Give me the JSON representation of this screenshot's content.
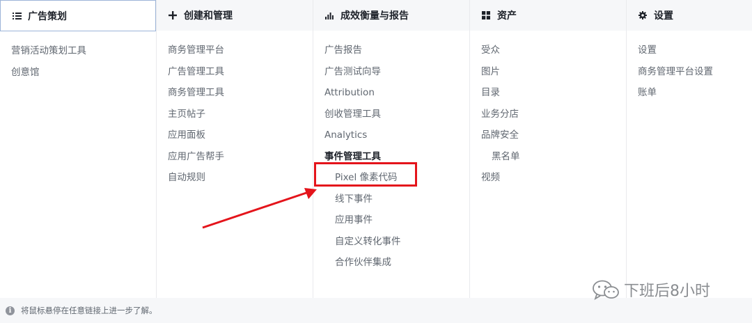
{
  "columns": [
    {
      "title": "广告策划",
      "icon": "list-icon",
      "items": [
        "营销活动策划工具",
        "创意馆"
      ]
    },
    {
      "title": "创建和管理",
      "icon": "plus-icon",
      "items": [
        "商务管理平台",
        "广告管理工具",
        "商务管理工具",
        "主页帖子",
        "应用面板",
        "应用广告帮手",
        "自动规则"
      ]
    },
    {
      "title": "成效衡量与报告",
      "icon": "bar-chart-icon",
      "items": [
        "广告报告",
        "广告测试向导",
        "Attribution",
        "创收管理工具",
        "Analytics",
        "事件管理工具",
        "Pixel 像素代码",
        "线下事件",
        "应用事件",
        "自定义转化事件",
        "合作伙伴集成"
      ]
    },
    {
      "title": "资产",
      "icon": "grid-icon",
      "items": [
        "受众",
        "图片",
        "目录",
        "业务分店",
        "品牌安全",
        "黑名单",
        "视频"
      ]
    },
    {
      "title": "设置",
      "icon": "gear-icon",
      "items": [
        "设置",
        "商务管理平台设置",
        "账单"
      ]
    }
  ],
  "footer": {
    "hint": "将鼠标悬停在任意链接上进一步了解。",
    "icon": "info-icon"
  },
  "watermark": {
    "text": "下班后8小时"
  },
  "colors": {
    "highlight": "#e4141b",
    "header_bg": "#f6f7f9",
    "active_border": "#9cb4d8"
  }
}
